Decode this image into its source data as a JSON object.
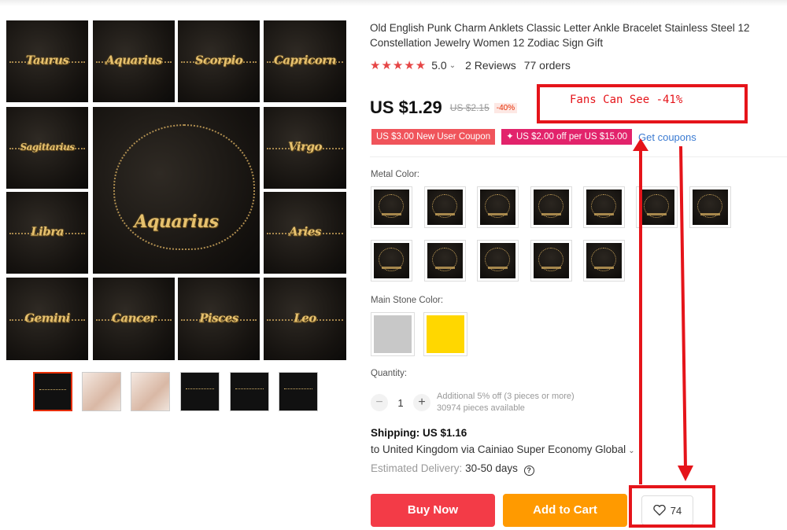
{
  "gallery": {
    "tiles": [
      "Taurus",
      "Aquarius",
      "Scorpio",
      "Capricorn",
      "Sagittarius",
      "Virgo",
      "Libra",
      "Aries",
      "Gemini",
      "Cancer",
      "Pisces",
      "Leo"
    ],
    "center_word": "Aquarius"
  },
  "product": {
    "title": "Old English Punk Charm Anklets Classic Letter Ankle Bracelet Stainless Steel 12 Constellation Jewelry Women 12 Zodiac Sign Gift",
    "stars": "★★★★★",
    "rating": "5.0",
    "reviews": "2 Reviews",
    "orders": "77 orders",
    "price": "US $1.29",
    "old_price": "US $2.15",
    "discount": "-40%",
    "coupons": [
      "US $3.00 New User Coupon",
      "✦ US $2.00 off per US $15.00"
    ],
    "get_coupons": "Get coupons"
  },
  "options": {
    "metal_label": "Metal Color:",
    "metal_swatches": [
      "Taurus",
      "Aquarius",
      "Scorpio",
      "Capricorn",
      "Sagittarius",
      "Virgo",
      "Libra",
      "Aries",
      "Cancer",
      "Gemini",
      "Pisces",
      "Leo"
    ],
    "stone_label": "Main Stone Color:",
    "stone_colors": [
      "#c8c8c8",
      "#ffd700"
    ]
  },
  "quantity": {
    "label": "Quantity:",
    "value": "1",
    "note1": "Additional 5% off (3 pieces or more)",
    "note2": "30974 pieces available",
    "minus": "−",
    "plus": "+"
  },
  "shipping": {
    "title": "Shipping: US $1.16",
    "dest": "to United Kingdom via Cainiao Super Economy Global",
    "delivery_label": "Estimated Delivery:",
    "delivery_days": "30-50 days",
    "help": "?"
  },
  "actions": {
    "buy": "Buy Now",
    "cart": "Add to Cart",
    "wish_count": "74"
  },
  "annotation": {
    "text": "Fans Can See -41%",
    "color": "#e5141a"
  }
}
